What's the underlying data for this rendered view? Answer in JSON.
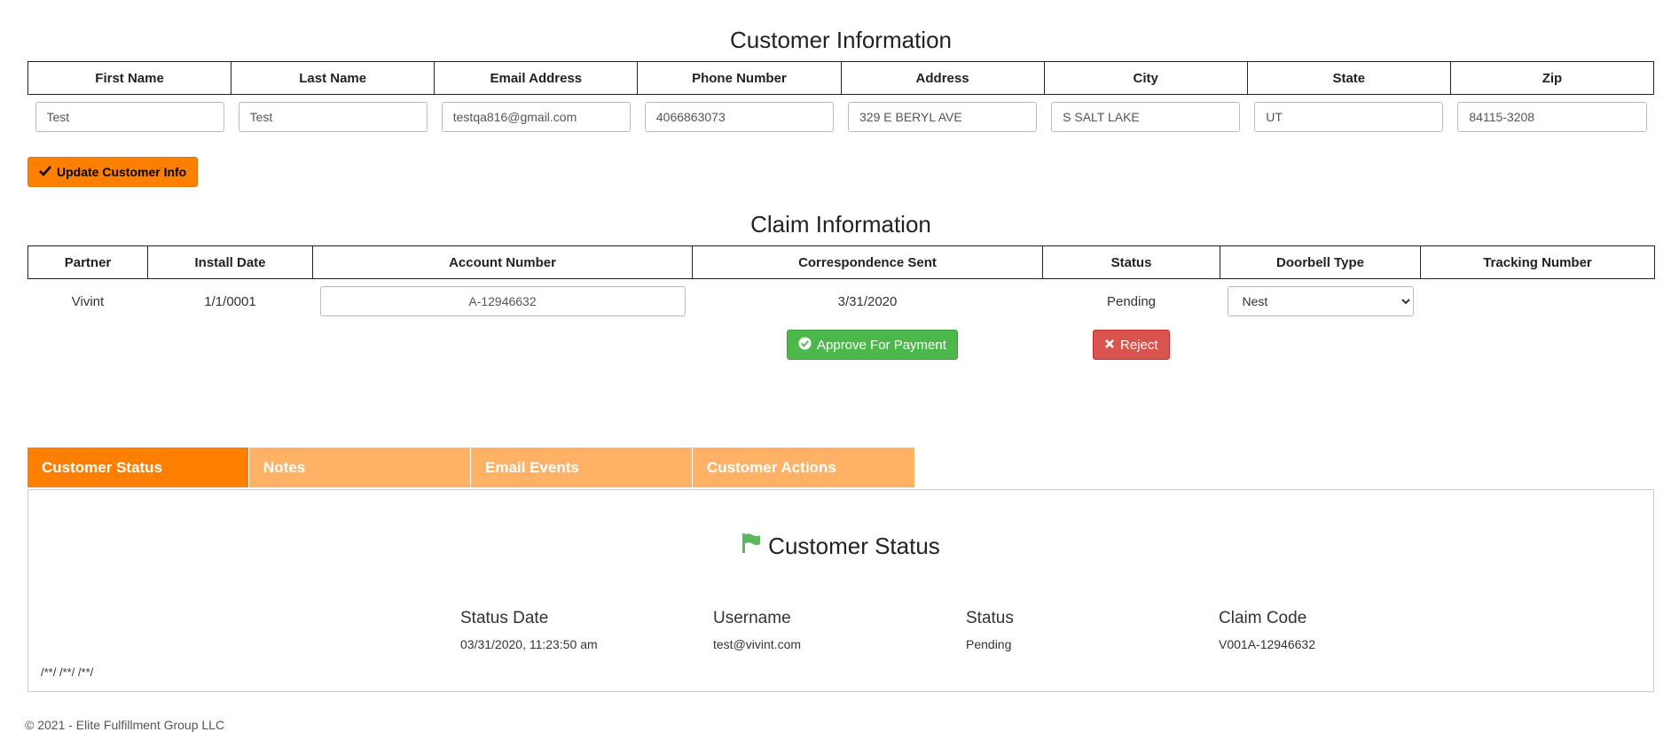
{
  "customer": {
    "title": "Customer Information",
    "columns": [
      "First Name",
      "Last Name",
      "Email Address",
      "Phone Number",
      "Address",
      "City",
      "State",
      "Zip"
    ],
    "values": [
      "Test",
      "Test",
      "testqa816@gmail.com",
      "4066863073",
      "329 E BERYL AVE",
      "S SALT LAKE",
      "UT",
      "84115-3208"
    ],
    "update_label": "Update Customer Info"
  },
  "claim": {
    "title": "Claim Information",
    "columns": [
      "Partner",
      "Install Date",
      "Account Number",
      "Correspondence Sent",
      "Status",
      "Doorbell Type",
      "Tracking Number"
    ],
    "partner": "Vivint",
    "install_date": "1/1/0001",
    "account_number": "A-12946632",
    "correspondence_sent": "3/31/2020",
    "status": "Pending",
    "doorbell_type": "Nest",
    "approve_label": "Approve For Payment",
    "reject_label": "Reject"
  },
  "tabs": [
    "Customer Status",
    "Notes",
    "Email Events",
    "Customer Actions"
  ],
  "customer_status": {
    "title": "Customer Status",
    "headers": [
      "Status Date",
      "Username",
      "Status",
      "Claim Code"
    ],
    "values": [
      "03/31/2020, 11:23:50 am",
      "test@vivint.com",
      "Pending",
      "V001A-12946632"
    ],
    "foot": "/**/ /**/ /**/"
  },
  "footer": {
    "text": "© 2021 - Elite Fulfillment Group LLC"
  },
  "colors": {
    "accent": "#ff8000",
    "tab_inactive": "#ffb266",
    "success": "#4cb84c",
    "danger": "#d9534f"
  }
}
